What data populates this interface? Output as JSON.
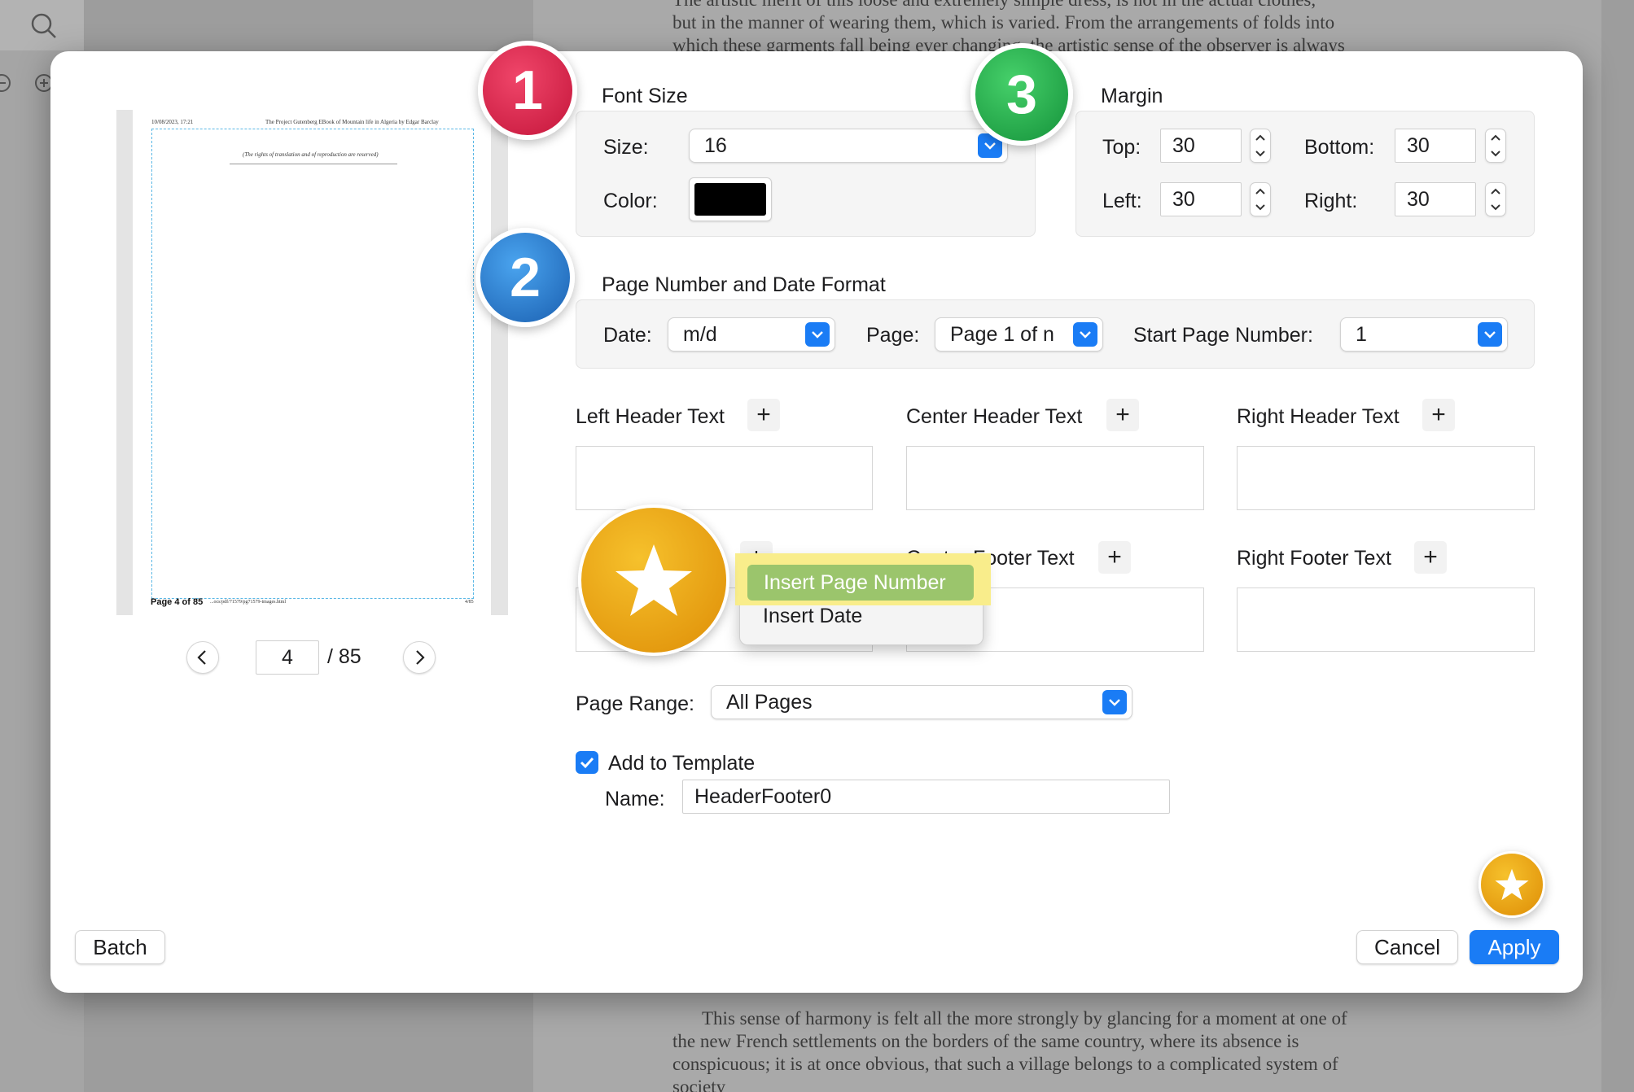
{
  "background": {
    "text_top": [
      "The artistic merit of this loose and extremely simple dress, is not in the actual clothes,",
      "but in the manner of wearing them, which is varied. From the arrangements of folds into",
      "which these garments fall being ever changing, the artistic sense of the observer is always"
    ],
    "text_bottom": [
      "This sense of harmony is felt all the more strongly by glancing for a moment at one of",
      "the new French settlements on the borders of the same country, where its absence is",
      "conspicuous; it is at once obvious, that such a village belongs to a complicated system of",
      "society"
    ]
  },
  "preview": {
    "header_left": "10/08/2023, 17:21",
    "header_center": "The Project Gutenberg EBook of Mountain life in Algeria by Edgar Barclay",
    "subtitle": "(The rights of translation and of reproduction are reserved)",
    "footer_left": "Page 4 of 85",
    "footer_mid": "...ocs/pdf/71579/pg71579-images.html",
    "footer_right": "4/85",
    "current_page": "4",
    "total_pages": "/ 85"
  },
  "font_size": {
    "title": "Font Size",
    "size_label": "Size:",
    "size_value": "16",
    "color_label": "Color:",
    "color_value": "#000000"
  },
  "margin": {
    "title": "Margin",
    "top_label": "Top:",
    "top_value": "30",
    "bottom_label": "Bottom:",
    "bottom_value": "30",
    "left_label": "Left:",
    "left_value": "30",
    "right_label": "Right:",
    "right_value": "30"
  },
  "page_number_date": {
    "title": "Page Number and Date Format",
    "date_label": "Date:",
    "date_value": "m/d",
    "page_label": "Page:",
    "page_value": "Page 1 of n",
    "start_label": "Start Page Number:",
    "start_value": "1"
  },
  "headers": {
    "left": "Left Header Text",
    "center": "Center Header Text",
    "right": "Right Header Text"
  },
  "footers": {
    "center": "Center Footer Text",
    "right": "Right Footer Text"
  },
  "context_menu": {
    "insert_page_number": "Insert Page Number",
    "insert_date": "Insert Date"
  },
  "page_range": {
    "label": "Page Range:",
    "value": "All Pages"
  },
  "template": {
    "checkbox_label": "Add to Template",
    "checked": true,
    "name_label": "Name:",
    "name_value": "HeaderFooter0"
  },
  "buttons": {
    "batch": "Batch",
    "cancel": "Cancel",
    "apply": "Apply"
  },
  "badges": {
    "one": "1",
    "two": "2",
    "three": "3"
  },
  "colors": {
    "accent": "#1a7cf5",
    "badge_red": "#d0213f",
    "badge_blue": "#1f6fc4",
    "badge_green": "#1fa543",
    "badge_gold": "#e8a60f"
  }
}
